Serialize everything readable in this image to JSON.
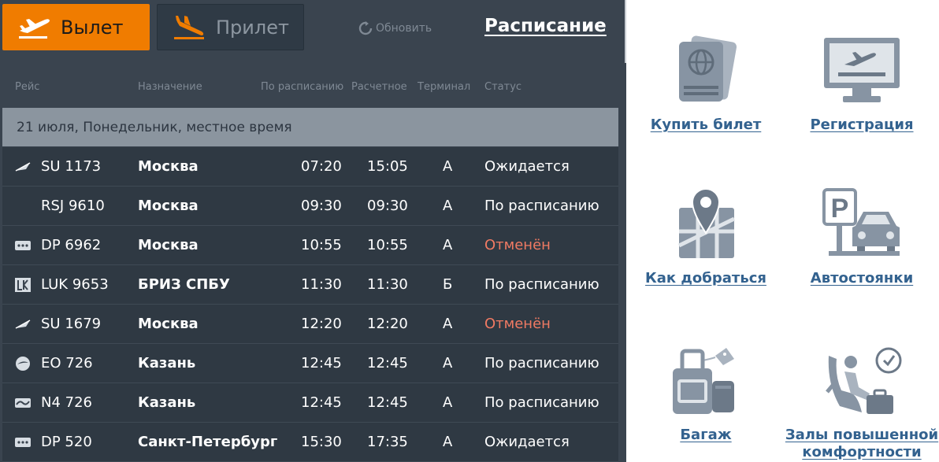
{
  "tabs": {
    "departure_label": "Вылет",
    "arrival_label": "Прилет"
  },
  "toolbar": {
    "refresh_label": "Обновить",
    "schedule_label": "Расписание"
  },
  "table": {
    "headers": {
      "flight": "Рейс",
      "destination": "Назначение",
      "scheduled": "По расписанию",
      "estimated": "Расчетное",
      "terminal": "Терминал",
      "status": "Статус"
    },
    "date_label": "21 июля, Понедельник, местное время",
    "rows": [
      {
        "airline_icon": "aeroflot-logo",
        "flight": "SU 1173",
        "destination": "Москва",
        "scheduled": "07:20",
        "estimated": "15:05",
        "terminal": "A",
        "status": "Ожидается",
        "cancelled": false
      },
      {
        "airline_icon": "",
        "flight": "RSJ 9610",
        "destination": "Москва",
        "scheduled": "09:30",
        "estimated": "09:30",
        "terminal": "A",
        "status": "По расписанию",
        "cancelled": false
      },
      {
        "airline_icon": "pobeda-logo",
        "flight": "DP 6962",
        "destination": "Москва",
        "scheduled": "10:55",
        "estimated": "10:55",
        "terminal": "A",
        "status": "Отменён",
        "cancelled": true
      },
      {
        "airline_icon": "lukoil-logo",
        "flight": "LUK 9653",
        "destination": "БРИЗ СПБУ",
        "scheduled": "11:30",
        "estimated": "11:30",
        "terminal": "Б",
        "status": "По расписанию",
        "cancelled": false
      },
      {
        "airline_icon": "aeroflot-logo",
        "flight": "SU 1679",
        "destination": "Москва",
        "scheduled": "12:20",
        "estimated": "12:20",
        "terminal": "A",
        "status": "Отменён",
        "cancelled": true
      },
      {
        "airline_icon": "pegas-logo",
        "flight": "EO 726",
        "destination": "Казань",
        "scheduled": "12:45",
        "estimated": "12:45",
        "terminal": "A",
        "status": "По расписанию",
        "cancelled": false
      },
      {
        "airline_icon": "nordwind-logo",
        "flight": "N4 726",
        "destination": "Казань",
        "scheduled": "12:45",
        "estimated": "12:45",
        "terminal": "A",
        "status": "По расписанию",
        "cancelled": false
      },
      {
        "airline_icon": "pobeda-logo",
        "flight": "DP 520",
        "destination": "Санкт-Петербург",
        "scheduled": "15:30",
        "estimated": "17:35",
        "terminal": "A",
        "status": "Ожидается",
        "cancelled": false
      }
    ]
  },
  "services": [
    {
      "icon": "passport-icon",
      "label": "Купить билет"
    },
    {
      "icon": "departure-monitor-icon",
      "label": "Регистрация"
    },
    {
      "icon": "map-pin-icon",
      "label": "Как добраться"
    },
    {
      "icon": "parking-icon",
      "label": "Автостоянки"
    },
    {
      "icon": "luggage-icon",
      "label": "Багаж"
    },
    {
      "icon": "lounge-seat-icon",
      "label": "Залы повышенной комфортности"
    }
  ],
  "colors": {
    "accent": "#f07c00",
    "board_bg": "#3a444f",
    "row_bg": "#2f3943",
    "cancelled": "#f07a63",
    "link": "#33628f",
    "icon_fill": "#8794a3"
  }
}
